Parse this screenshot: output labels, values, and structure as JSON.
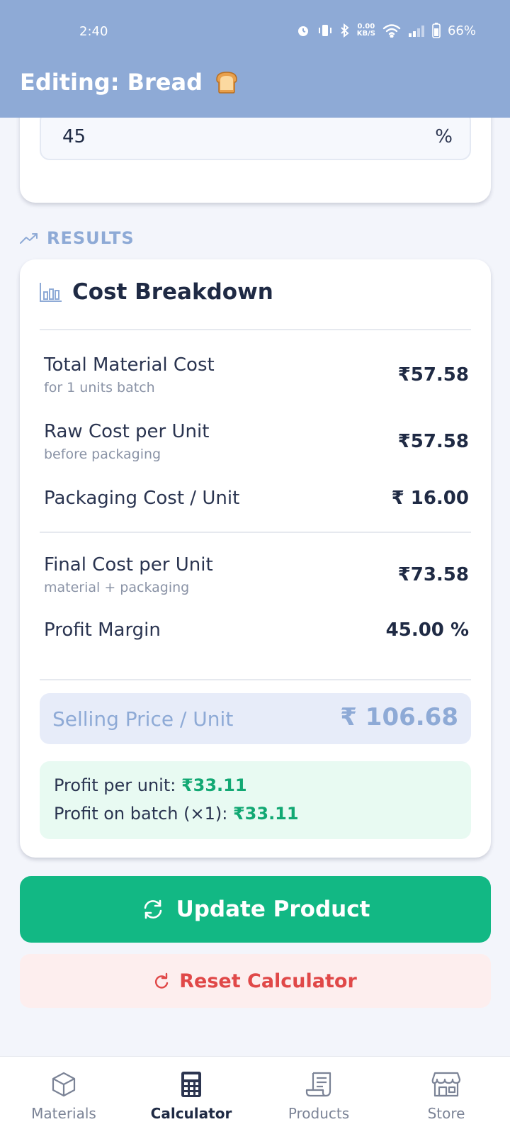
{
  "status_bar": {
    "time": "2:40",
    "net_speed_value": "0.00",
    "net_speed_unit": "KB/S",
    "battery": "66%"
  },
  "header": {
    "title": "Editing: Bread",
    "icon": "bread-icon",
    "background": "#8eaad6"
  },
  "margin_field": {
    "value": "45",
    "unit": "%"
  },
  "results": {
    "section_label": "RESULTS",
    "icon": "trending-up-icon"
  },
  "cost_breakdown": {
    "title": "Cost Breakdown",
    "icon": "bar-chart-icon",
    "rows": [
      {
        "label": "Total Material Cost",
        "sub": "for 1 units batch",
        "value": "₹57.58"
      },
      {
        "label": "Raw Cost per Unit",
        "sub": "before packaging",
        "value": "₹57.58"
      },
      {
        "label": "Packaging Cost / Unit",
        "sub": "",
        "value": "₹ 16.00"
      },
      {
        "label": "Final Cost per Unit",
        "sub": "material + packaging",
        "value": "₹73.58"
      },
      {
        "label": "Profit Margin",
        "sub": "",
        "value": "45.00 %"
      }
    ],
    "selling_price": {
      "label": "Selling Price / Unit",
      "value": "₹ 106.68"
    },
    "profit": {
      "per_unit_label": "Profit per unit: ",
      "per_unit_value": "₹33.11",
      "batch_label": "Profit on batch (×1): ",
      "batch_value": "₹33.11"
    }
  },
  "actions": {
    "update_label": "Update Product",
    "reset_label": "Reset Calculator"
  },
  "bottom_nav": {
    "items": [
      {
        "label": "Materials",
        "icon": "box-icon"
      },
      {
        "label": "Calculator",
        "icon": "calculator-icon",
        "active": true
      },
      {
        "label": "Products",
        "icon": "receipt-icon"
      },
      {
        "label": "Store",
        "icon": "store-icon"
      }
    ]
  },
  "colors": {
    "accent": "#8eaad6",
    "success": "#12b884",
    "danger": "#e04848"
  }
}
